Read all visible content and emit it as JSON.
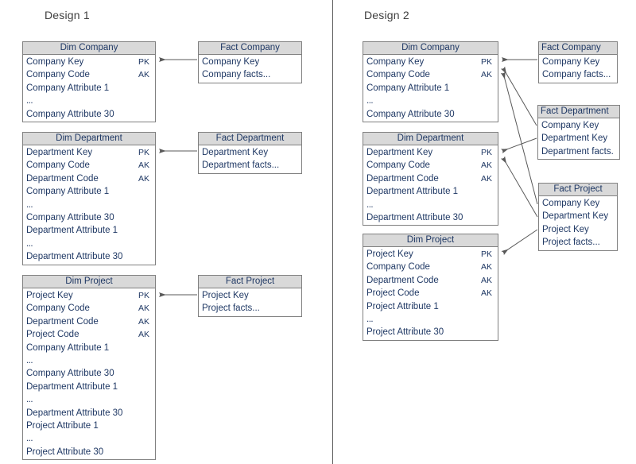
{
  "panels": [
    {
      "title": "Design 1"
    },
    {
      "title": "Design 2"
    }
  ],
  "colors": {
    "header_fill": "#d9d9d9",
    "border": "#808080",
    "text": "#1f3864",
    "title_text": "#404040",
    "arrow": "#595959",
    "divider": "#595959"
  },
  "labels": {
    "pk": "PK",
    "ak": "AK",
    "ellipsis": "..."
  },
  "design1": {
    "dim_company": {
      "header": "Dim Company",
      "rows": [
        {
          "name": "Company Key",
          "key": "PK"
        },
        {
          "name": "Company Code",
          "key": "AK"
        },
        {
          "name": "Company Attribute 1",
          "key": ""
        },
        {
          "name": "...",
          "key": ""
        },
        {
          "name": "Company Attribute 30",
          "key": ""
        }
      ]
    },
    "fact_company": {
      "header": "Fact Company",
      "rows": [
        {
          "name": "Company Key",
          "key": ""
        },
        {
          "name": "Company facts...",
          "key": ""
        }
      ]
    },
    "dim_department": {
      "header": "Dim Department",
      "rows": [
        {
          "name": "Department Key",
          "key": "PK"
        },
        {
          "name": "Company Code",
          "key": "AK"
        },
        {
          "name": "Department Code",
          "key": "AK"
        },
        {
          "name": "Company Attribute 1",
          "key": ""
        },
        {
          "name": "...",
          "key": ""
        },
        {
          "name": "Company Attribute 30",
          "key": ""
        },
        {
          "name": "Department Attribute 1",
          "key": ""
        },
        {
          "name": "...",
          "key": ""
        },
        {
          "name": "Department Attribute 30",
          "key": ""
        }
      ]
    },
    "fact_department": {
      "header": "Fact Department",
      "rows": [
        {
          "name": "Department Key",
          "key": ""
        },
        {
          "name": "Department facts...",
          "key": ""
        }
      ]
    },
    "dim_project": {
      "header": "Dim Project",
      "rows": [
        {
          "name": "Project Key",
          "key": "PK"
        },
        {
          "name": "Company Code",
          "key": "AK"
        },
        {
          "name": "Department Code",
          "key": "AK"
        },
        {
          "name": "Project Code",
          "key": "AK"
        },
        {
          "name": "Company Attribute 1",
          "key": ""
        },
        {
          "name": "...",
          "key": ""
        },
        {
          "name": "Company Attribute 30",
          "key": ""
        },
        {
          "name": "Department Attribute 1",
          "key": ""
        },
        {
          "name": "...",
          "key": ""
        },
        {
          "name": "Department Attribute 30",
          "key": ""
        },
        {
          "name": "Project Attribute 1",
          "key": ""
        },
        {
          "name": "...",
          "key": ""
        },
        {
          "name": "Project Attribute 30",
          "key": ""
        }
      ]
    },
    "fact_project": {
      "header": "Fact Project",
      "rows": [
        {
          "name": "Project Key",
          "key": ""
        },
        {
          "name": "Project facts...",
          "key": ""
        }
      ]
    }
  },
  "design2": {
    "dim_company": {
      "header": "Dim Company",
      "rows": [
        {
          "name": "Company Key",
          "key": "PK"
        },
        {
          "name": "Company Code",
          "key": "AK"
        },
        {
          "name": "Company Attribute 1",
          "key": ""
        },
        {
          "name": "...",
          "key": ""
        },
        {
          "name": "Company Attribute 30",
          "key": ""
        }
      ]
    },
    "fact_company": {
      "header": "Fact Company",
      "rows": [
        {
          "name": "Company Key",
          "key": ""
        },
        {
          "name": "Company facts...",
          "key": ""
        }
      ]
    },
    "dim_department": {
      "header": "Dim Department",
      "rows": [
        {
          "name": "Department Key",
          "key": "PK"
        },
        {
          "name": "Company Code",
          "key": "AK"
        },
        {
          "name": "Department Code",
          "key": "AK"
        },
        {
          "name": "Department Attribute 1",
          "key": ""
        },
        {
          "name": "...",
          "key": ""
        },
        {
          "name": "Department Attribute 30",
          "key": ""
        }
      ]
    },
    "fact_department": {
      "header": "Fact Department",
      "rows": [
        {
          "name": "Company Key",
          "key": ""
        },
        {
          "name": "Department Key",
          "key": ""
        },
        {
          "name": "Department facts...",
          "key": ""
        }
      ]
    },
    "dim_project": {
      "header": "Dim Project",
      "rows": [
        {
          "name": "Project Key",
          "key": "PK"
        },
        {
          "name": "Company Code",
          "key": "AK"
        },
        {
          "name": "Department Code",
          "key": "AK"
        },
        {
          "name": "Project Code",
          "key": "AK"
        },
        {
          "name": "Project Attribute 1",
          "key": ""
        },
        {
          "name": "...",
          "key": ""
        },
        {
          "name": "Project Attribute 30",
          "key": ""
        }
      ]
    },
    "fact_project": {
      "header": "Fact Project",
      "rows": [
        {
          "name": "Company Key",
          "key": ""
        },
        {
          "name": "Department Key",
          "key": ""
        },
        {
          "name": "Project Key",
          "key": ""
        },
        {
          "name": "Project facts...",
          "key": ""
        }
      ]
    }
  }
}
